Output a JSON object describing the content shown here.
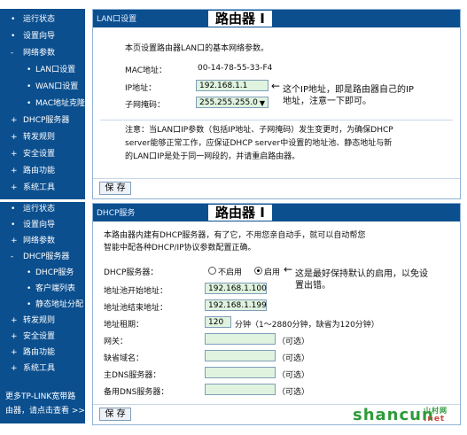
{
  "top_sidebar": {
    "items": [
      {
        "label": "运行状态",
        "bullet": "•"
      },
      {
        "label": "设置向导",
        "bullet": "•"
      },
      {
        "label": "网络参数",
        "bullet": "-"
      },
      {
        "label": "LAN口设置",
        "bullet": "•"
      },
      {
        "label": "WAN口设置",
        "bullet": "•"
      },
      {
        "label": "MAC地址克隆",
        "bullet": "•"
      },
      {
        "label": "DHCP服务器",
        "bullet": "+"
      },
      {
        "label": "转发规则",
        "bullet": "+"
      },
      {
        "label": "安全设置",
        "bullet": "+"
      },
      {
        "label": "路由功能",
        "bullet": "+"
      },
      {
        "label": "系统工具",
        "bullet": "+"
      }
    ]
  },
  "lan_panel": {
    "tab": "LAN口设置",
    "title": "路由器 I",
    "intro": "本页设置路由器LAN口的基本网络参数。",
    "mac_label": "MAC地址：",
    "mac_value": "00-14-78-55-33-F4",
    "ip_label": "IP地址：",
    "ip_value": "192.168.1.1",
    "mask_label": "子网掩码：",
    "mask_value": "255.255.255.0",
    "ip_note_1": "这个IP地址，即是路由器自己的IP",
    "ip_note_2": "地址，注意一下即可。",
    "notice_1": "注意：当LAN口IP参数（包括IP地址、子网掩码）发生变更时，为确保DHCP",
    "notice_2": "server能够正常工作，应保证DHCP server中设置的地址池、静态地址与新",
    "notice_3": "的LAN口IP是处于同一网段的，并请重启路由器。",
    "save": "保 存"
  },
  "bottom_sidebar": {
    "items": [
      {
        "label": "运行状态",
        "bullet": "•"
      },
      {
        "label": "设置向导",
        "bullet": "•"
      },
      {
        "label": "网络参数",
        "bullet": "+"
      },
      {
        "label": "DHCP服务器",
        "bullet": "-"
      },
      {
        "label": "DHCP服务",
        "bullet": "•"
      },
      {
        "label": "客户端列表",
        "bullet": "•"
      },
      {
        "label": "静态地址分配",
        "bullet": "•"
      },
      {
        "label": "转发规则",
        "bullet": "+"
      },
      {
        "label": "安全设置",
        "bullet": "+"
      },
      {
        "label": "路由功能",
        "bullet": "+"
      },
      {
        "label": "系统工具",
        "bullet": "+"
      }
    ],
    "footer_1": "更多TP-LINK宽带路",
    "footer_2": "由器，请点击查看 >>"
  },
  "dhcp_panel": {
    "tab": "DHCP服务",
    "title": "路由器 I",
    "intro_1": "本路由器内建有DHCP服务器，有了它，不用您亲自动手，就可以自动帮您",
    "intro_2": "智能中配各种DHCP/IP协议参数配置正确。",
    "server_label": "DHCP服务器：",
    "disable": "不启用",
    "enable": "启用",
    "server_note_1": "这是最好保持默认的启用，以免设",
    "server_note_2": "置出错。",
    "start_label": "地址池开始地址：",
    "start_value": "192.168.1.100",
    "end_label": "地址池结束地址：",
    "end_value": "192.168.1.199",
    "lease_label": "地址租期：",
    "lease_value": "120",
    "lease_note": "分钟（1～2880分钟，缺省为120分钟）",
    "gateway_label": "网关：",
    "domain_label": "缺省域名：",
    "dns1_label": "主DNS服务器：",
    "dns2_label": "备用DNS服务器：",
    "optional": "（可选）",
    "save": "保 存"
  },
  "watermark": {
    "main": "shancun",
    "suffix": ".net",
    "small": "山村网"
  }
}
